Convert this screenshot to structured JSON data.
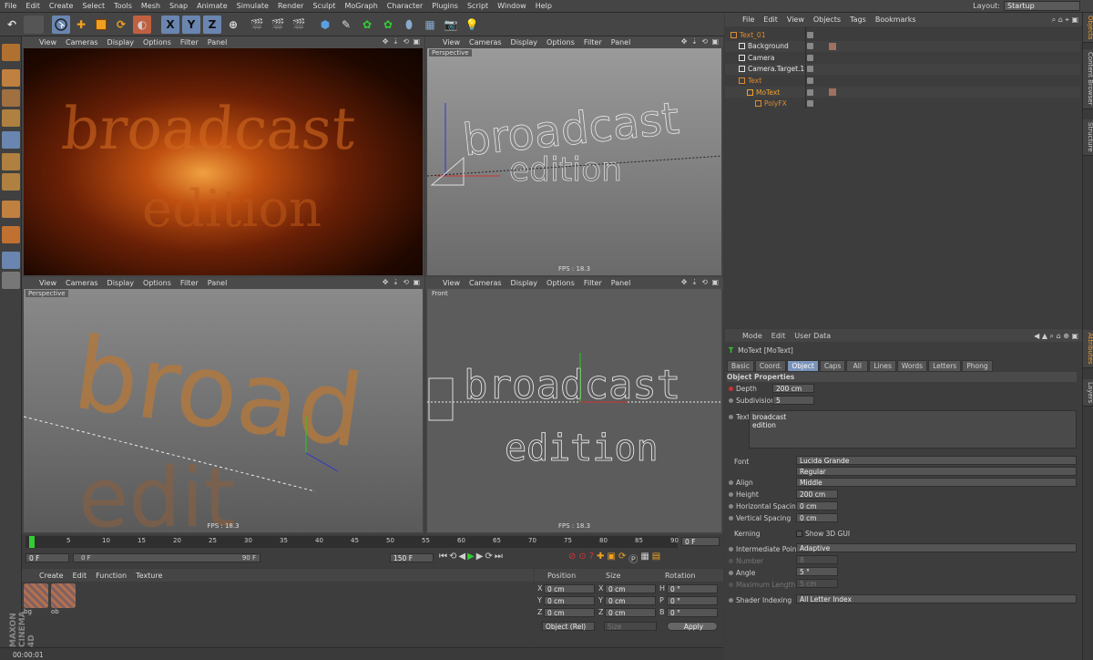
{
  "menubar": {
    "items": [
      "File",
      "Edit",
      "Create",
      "Select",
      "Tools",
      "Mesh",
      "Snap",
      "Animate",
      "Simulate",
      "Render",
      "Sculpt",
      "MoGraph",
      "Character",
      "Plugins",
      "Script",
      "Window",
      "Help"
    ],
    "layout_label": "Layout:",
    "layout_value": "Startup"
  },
  "toolbar": {
    "axis_x": "X",
    "axis_y": "Y",
    "axis_z": "Z"
  },
  "viewports": {
    "menu": [
      "View",
      "Cameras",
      "Display",
      "Options",
      "Filter",
      "Panel"
    ],
    "tl": {
      "label": ""
    },
    "tr": {
      "label": "Perspective",
      "fps": "FPS : 18.3"
    },
    "bl": {
      "label": "Perspective",
      "fps": "FPS : 18.3"
    },
    "br": {
      "label": "Front",
      "fps": "FPS : 18.3"
    }
  },
  "objects": {
    "menu": [
      "File",
      "Edit",
      "View",
      "Objects",
      "Tags",
      "Bookmarks"
    ],
    "rows": [
      {
        "name": "Text_01",
        "color": "#e08a30",
        "indent": 0
      },
      {
        "name": "Background",
        "color": "#e6e6e6",
        "indent": 1
      },
      {
        "name": "Camera",
        "color": "#e6e6e6",
        "indent": 1
      },
      {
        "name": "Camera.Target.1",
        "color": "#e6e6e6",
        "indent": 1
      },
      {
        "name": "Text",
        "color": "#e08a30",
        "indent": 1
      },
      {
        "name": "MoText",
        "color": "#f0a030",
        "indent": 2
      },
      {
        "name": "PolyFX",
        "color": "#e08a30",
        "indent": 3
      }
    ]
  },
  "sidetabs": {
    "top": [
      "Objects",
      "Content Browser",
      "Structure"
    ],
    "bottom": [
      "Attributes",
      "Layers"
    ]
  },
  "attributes": {
    "menu": [
      "Mode",
      "Edit",
      "User Data"
    ],
    "object_name": "MoText [MoText]",
    "tabs": [
      "Basic",
      "Coord.",
      "Object",
      "Caps",
      "All",
      "Lines",
      "Words",
      "Letters",
      "Phong"
    ],
    "section": "Object Properties",
    "depth_label": "Depth",
    "depth_value": "200 cm",
    "subdivision_label": "Subdivision",
    "subdivision_value": "5",
    "text_label": "Text",
    "text_line1": "broadcast",
    "text_line2": "edition",
    "font_label": "Font",
    "font_value": "Lucida Grande",
    "font_style": "Regular",
    "align_label": "Align",
    "align_value": "Middle",
    "height_label": "Height",
    "height_value": "200 cm",
    "hspacing_label": "Horizontal Spacing",
    "hspacing_value": "0 cm",
    "vspacing_label": "Vertical Spacing",
    "vspacing_value": "0 cm",
    "kerning_label": "Kerning",
    "show3d_label": "Show 3D GUI",
    "ipoints_label": "Intermediate Points",
    "ipoints_value": "Adaptive",
    "number_label": "Number",
    "number_value": "8",
    "angle_label": "Angle",
    "angle_value": "5 °",
    "maxlen_label": "Maximum Length",
    "maxlen_value": "5 cm",
    "shader_label": "Shader Indexing",
    "shader_value": "All Letter Index"
  },
  "timeline": {
    "ticks": [
      "0",
      "5",
      "10",
      "15",
      "20",
      "25",
      "30",
      "35",
      "40",
      "45",
      "50",
      "55",
      "60",
      "65",
      "70",
      "75",
      "80",
      "85",
      "90"
    ],
    "current_frame": "0 F",
    "start": "0 F",
    "range_start": "0 F",
    "range_end": "90 F",
    "end": "150 F"
  },
  "materials": {
    "menu": [
      "Create",
      "Edit",
      "Function",
      "Texture"
    ],
    "items": [
      "bg",
      "ob"
    ]
  },
  "coordinates": {
    "headers": [
      "Position",
      "Size",
      "Rotation"
    ],
    "rows": [
      {
        "a": "X",
        "p": "0 cm",
        "b": "X",
        "s": "0 cm",
        "c": "H",
        "r": "0 °"
      },
      {
        "a": "Y",
        "p": "0 cm",
        "b": "Y",
        "s": "0 cm",
        "c": "P",
        "r": "0 °"
      },
      {
        "a": "Z",
        "p": "0 cm",
        "b": "Z",
        "s": "0 cm",
        "c": "B",
        "r": "0 °"
      }
    ],
    "mode": "Object (Rel)",
    "size_mode": "Size",
    "apply": "Apply"
  },
  "status": {
    "time": "00:00:01"
  },
  "brand": "MAXON CINEMA 4D"
}
